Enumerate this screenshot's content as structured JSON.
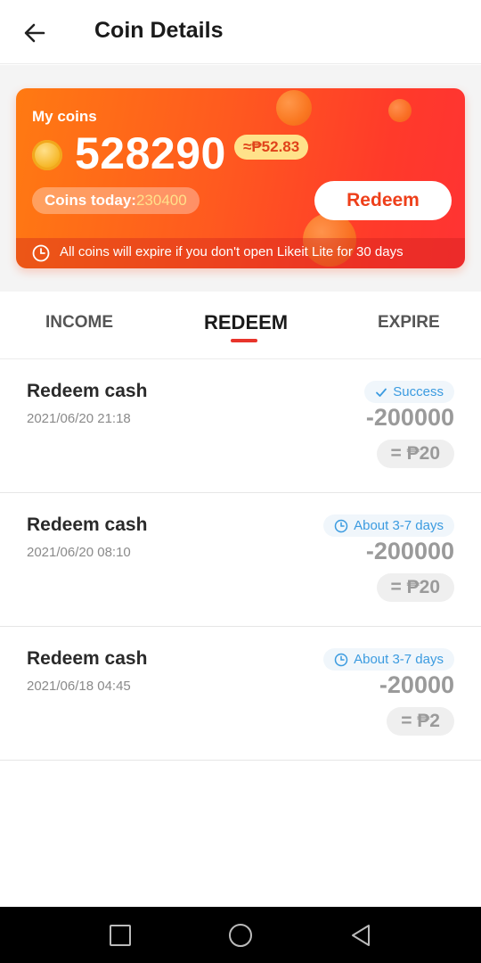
{
  "header": {
    "title": "Coin Details"
  },
  "card": {
    "my_coins_label": "My coins",
    "coin_amount": "528290",
    "peso_equivalent": "≈₱52.83",
    "today_label": "Coins today:",
    "today_value": "230400",
    "redeem_label": "Redeem",
    "expire_notice": "All coins will expire if you don't open Likeit Lite for 30 days"
  },
  "tabs": [
    {
      "label": "INCOME",
      "active": false
    },
    {
      "label": "REDEEM",
      "active": true
    },
    {
      "label": "EXPIRE",
      "active": false
    }
  ],
  "transactions": [
    {
      "title": "Redeem cash",
      "date": "2021/06/20 21:18",
      "status": "Success",
      "status_icon": "check-icon",
      "amount": "-200000",
      "peso": "= ₱20"
    },
    {
      "title": "Redeem cash",
      "date": "2021/06/20 08:10",
      "status": "About 3-7 days",
      "status_icon": "clock-icon",
      "amount": "-200000",
      "peso": "= ₱20"
    },
    {
      "title": "Redeem cash",
      "date": "2021/06/18 04:45",
      "status": "About 3-7 days",
      "status_icon": "clock-icon",
      "amount": "-20000",
      "peso": "= ₱2"
    }
  ],
  "colors": {
    "accent": "#ff5a1f",
    "status_blue": "#3b9be0",
    "tab_underline": "#e8342b"
  }
}
